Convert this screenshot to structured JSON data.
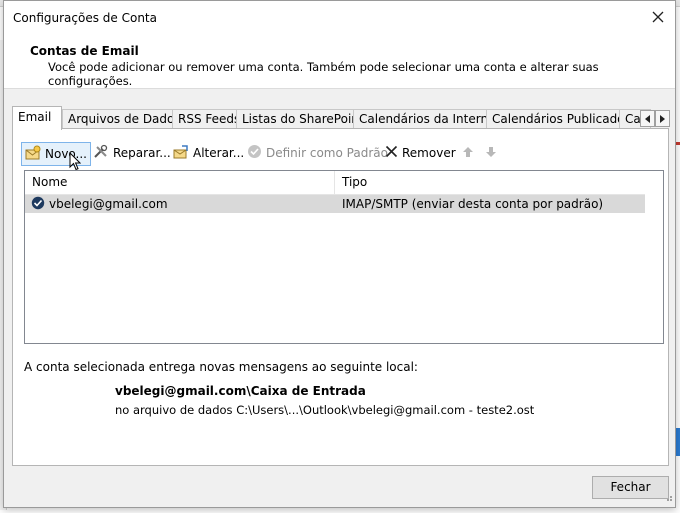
{
  "background_hint": "",
  "dialog": {
    "title": "Configurações de Conta",
    "close_glyph": "✕",
    "header_title": "Contas de Email",
    "header_description": "Você pode adicionar ou remover uma conta. Também pode selecionar uma conta e alterar suas configurações."
  },
  "tabs": [
    {
      "label": "Email",
      "active": true
    },
    {
      "label": "Arquivos de Dados"
    },
    {
      "label": "RSS Feeds"
    },
    {
      "label": "Listas do SharePoint"
    },
    {
      "label": "Calendários da Internet"
    },
    {
      "label": "Calendários Publicados"
    },
    {
      "label": "Ca"
    }
  ],
  "toolbar": {
    "new_label": "Novo...",
    "repair_label": "Reparar...",
    "change_label": "Alterar...",
    "default_label": "Definir como Padrão",
    "remove_label": "Remover"
  },
  "accounts_table": {
    "columns": [
      "Nome",
      "Tipo"
    ],
    "rows": [
      {
        "name": "vbelegi@gmail.com",
        "type": "IMAP/SMTP (enviar desta conta por padrão)"
      }
    ]
  },
  "delivery": {
    "info": "A conta selecionada entrega novas mensagens ao seguinte local:",
    "location": "vbelegi@gmail.com\\Caixa de Entrada",
    "data_file": "no arquivo de dados C:\\Users\\...\\Outlook\\vbelegi@gmail.com - teste2.ost"
  },
  "footer": {
    "close_button": "Fechar"
  },
  "colors": {
    "accent": "#2b7cd3",
    "selection": "#d9d9d9",
    "dialog_bg": "#f0f0f0"
  }
}
